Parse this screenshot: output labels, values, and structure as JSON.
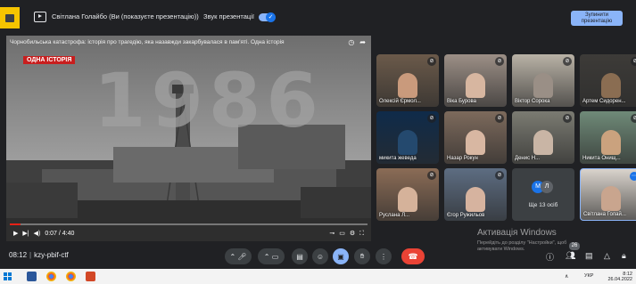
{
  "topbar": {
    "presenting_text": "Світлана Голайбо (Ви (показуєте презентацію))",
    "sound_label": "Звук презентації",
    "stop_button": "Зупинити презентацію"
  },
  "video": {
    "title": "Чорнобильська катастрофа: історія про трагедію, яка назавжди закарбувалася в пам'яті. Одна історія",
    "badge": "ОДНА ІСТОРІЯ",
    "year": "1986",
    "time": "0:07 / 4:40",
    "progress": 0.03
  },
  "participants": [
    {
      "name": "Олексій Єрмол...",
      "bg": "#6b5a4a",
      "skin": "#c99a7c"
    },
    {
      "name": "Віка Бурова",
      "bg": "#9c8f86",
      "skin": "#d7b6a0"
    },
    {
      "name": "Віктор Сорока",
      "bg": "#b9b2a6",
      "skin": "#9a8f86"
    },
    {
      "name": "Артем Сидорен...",
      "bg": "#3d3b38",
      "skin": "#8a6d52"
    },
    {
      "name": "микита жеведа",
      "bg": "#0f2b4a",
      "skin": "#24496e"
    },
    {
      "name": "Назар Рокун",
      "bg": "#7d6a5c",
      "skin": "#d8b7a2"
    },
    {
      "name": "Денис Н...",
      "bg": "#7b7b72",
      "skin": "#c9b5a5"
    },
    {
      "name": "Никита Онищ...",
      "bg": "#6f8a78",
      "skin": "#caa27e"
    },
    {
      "name": "Руслана Л...",
      "bg": "#8b6c56",
      "skin": "#d5b29a"
    },
    {
      "name": "Єгор Ружильов",
      "bg": "#5d6d82",
      "skin": "#d6b39f"
    },
    {
      "name": "Світлана Голай...",
      "bg": "#d9d3cc",
      "skin": "#c9a58e"
    }
  ],
  "more": {
    "label": "Ще 13 осіб",
    "avatar_a": "М",
    "avatar_b": "Л"
  },
  "watermark": {
    "title": "Активація Windows",
    "subtitle": "Перейдіть до розділу \"Настройки\", щоб активувати Windows."
  },
  "meeting": {
    "time": "08:12",
    "code": "kzy-pbif-ctf",
    "participant_count": "26"
  },
  "taskbar": {
    "lang": "УКР",
    "clock": "8:12",
    "date": "26.04.2022"
  },
  "colors": {
    "meet_bg": "#202124",
    "accent": "#8ab4f8",
    "end_call": "#ea4335",
    "badge_red": "#c81e1e"
  }
}
